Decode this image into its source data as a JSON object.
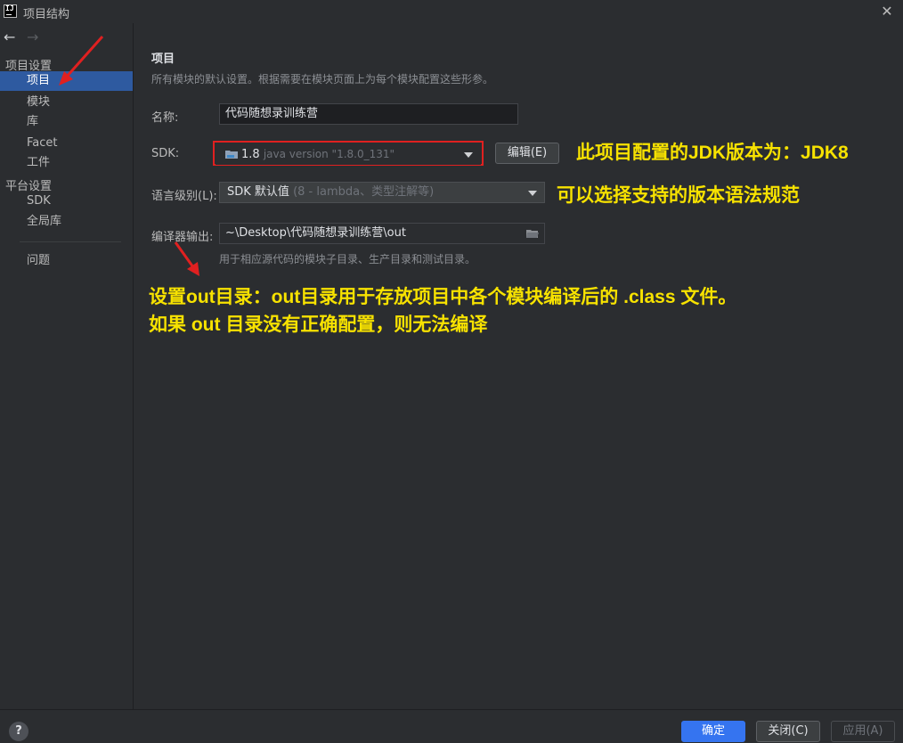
{
  "window": {
    "title": "项目结构",
    "app_icon": "IJ"
  },
  "nav": {
    "back": "←",
    "forward": "→"
  },
  "sidebar": {
    "section_project": "项目设置",
    "project_items": [
      {
        "label": "项目",
        "selected": true
      },
      {
        "label": "模块"
      },
      {
        "label": "库"
      },
      {
        "label": "Facet"
      },
      {
        "label": "工件"
      }
    ],
    "section_platform": "平台设置",
    "platform_items": [
      {
        "label": "SDK"
      },
      {
        "label": "全局库"
      }
    ],
    "problems": "问题"
  },
  "main": {
    "heading": "项目",
    "description": "所有模块的默认设置。根据需要在模块页面上为每个模块配置这些形参。",
    "name_label": "名称:",
    "name_value": "代码随想录训练营",
    "sdk_label": "SDK:",
    "sdk_version": "1.8",
    "sdk_detail": "java version \"1.8.0_131\"",
    "edit_button": "编辑(E)",
    "lang_label": "语言级别(L):",
    "lang_value": "SDK 默认值",
    "lang_detail": "(8 - lambda、类型注解等)",
    "output_label": "编译器输出:",
    "output_value": "~\\Desktop\\代码随想录训练营\\out",
    "output_hint": "用于相应源代码的模块子目录、生产目录和测试目录。"
  },
  "annotations": {
    "jdk_note": "此项目配置的JDK版本为：JDK8",
    "lang_note": "可以选择支持的版本语法规范",
    "out_note_line1": "设置out目录：out目录用于存放项目中各个模块编译后的 .class 文件。",
    "out_note_line2": "如果 out 目录没有正确配置，则无法编译",
    "color": "#f7e200",
    "arrow_color": "#e02020",
    "box_color": "#e02020"
  },
  "footer": {
    "help": "?",
    "ok": "确定",
    "close": "关闭(C)",
    "apply": "应用(A)"
  },
  "colors": {
    "background": "#2b2d30",
    "selection": "#2e5aa0",
    "primary_button": "#3574f0"
  }
}
